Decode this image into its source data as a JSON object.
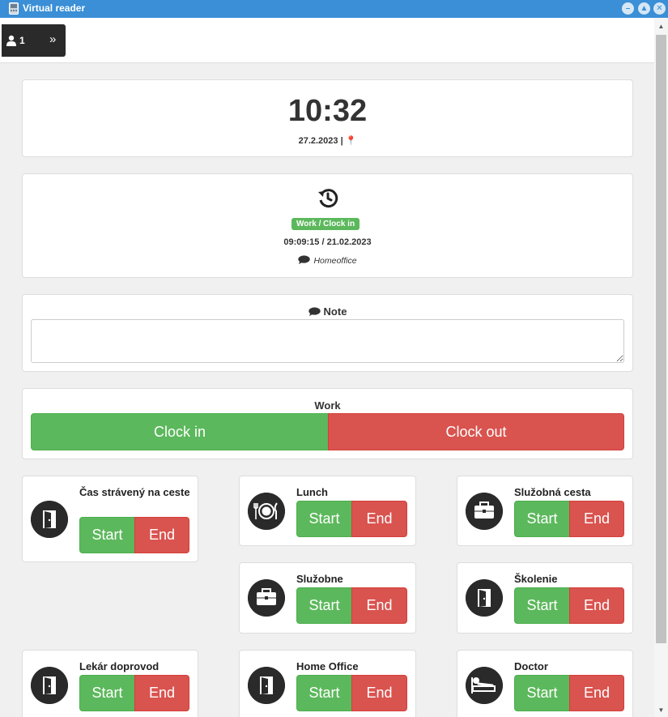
{
  "window": {
    "title": "Virtual reader"
  },
  "toolbar": {
    "user_count": "1",
    "expand_icon": "double-chevron-right-icon"
  },
  "clock": {
    "time": "10:32",
    "date": "27.2.2023 |"
  },
  "last_event": {
    "badge": "Work / Clock in",
    "time": "09:09:15",
    "separator": " / ",
    "date": "21.02.2023",
    "note": "Homeoffice"
  },
  "note": {
    "label": "Note",
    "value": ""
  },
  "work": {
    "label": "Work",
    "clock_in": "Clock in",
    "clock_out": "Clock out"
  },
  "activities": [
    {
      "title": "Čas strávený na ceste",
      "icon": "door-icon",
      "start": "Start",
      "end": "End"
    },
    {
      "title": "Lunch",
      "icon": "plate-fork-knife-icon",
      "start": "Start",
      "end": "End"
    },
    {
      "title": "Služobná cesta",
      "icon": "briefcase-icon",
      "start": "Start",
      "end": "End"
    },
    {
      "title": "Služobne",
      "icon": "briefcase-icon",
      "start": "Start",
      "end": "End"
    },
    {
      "title": "Školenie",
      "icon": "door-icon",
      "start": "Start",
      "end": "End"
    },
    {
      "title": "Lekár doprovod",
      "icon": "door-icon",
      "start": "Start",
      "end": "End"
    },
    {
      "title": "Home Office",
      "icon": "door-icon",
      "start": "Start",
      "end": "End"
    },
    {
      "title": "Doctor",
      "icon": "patient-bed-icon",
      "start": "Start",
      "end": "End"
    }
  ],
  "colors": {
    "titlebar": "#3a8fd6",
    "start": "#5cb85c",
    "end": "#d9534f",
    "dark": "#2a2a2a"
  }
}
